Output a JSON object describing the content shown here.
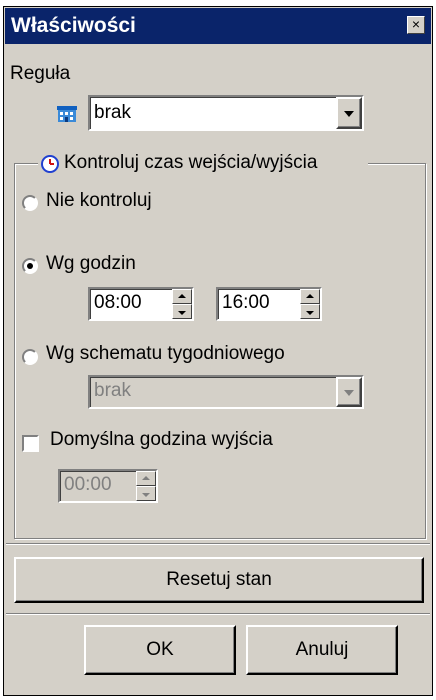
{
  "window": {
    "title": "Właściwości",
    "close_label": "×"
  },
  "rule": {
    "label": "Reguła",
    "selected": "brak",
    "icon": "building-icon"
  },
  "control": {
    "group_label": "Kontroluj czas wejścia/wyjścia",
    "icon": "clock-icon",
    "option_none": "Nie kontroluj",
    "option_hours": "Wg godzin",
    "selected_option": "Wg godzin",
    "time_from": "08:00",
    "time_to": "16:00",
    "option_weekly": "Wg schematu tygodniowego",
    "weekly_selected": "brak",
    "default_exit_label": "Domyślna godzina wyjścia",
    "default_exit_checked": false,
    "default_exit_time": "00:00"
  },
  "buttons": {
    "reset": "Resetuj stan",
    "ok": "OK",
    "cancel": "Anuluj"
  },
  "colors": {
    "titlebar": "#0a246a",
    "face": "#d4d0c8"
  }
}
